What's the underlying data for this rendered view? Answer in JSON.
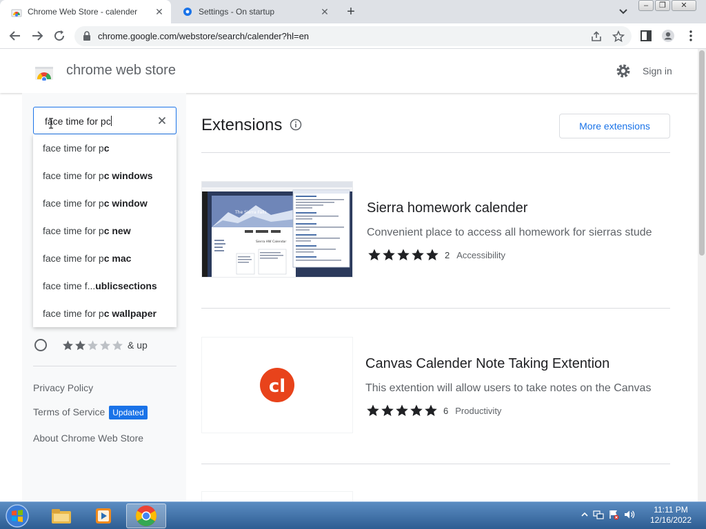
{
  "browser": {
    "tabs": [
      {
        "title": "Chrome Web Store - calender",
        "active": true
      },
      {
        "title": "Settings - On startup",
        "active": false
      }
    ],
    "address_url": "chrome.google.com/webstore/search/calender?hl=en"
  },
  "header": {
    "store_name": "chrome web store",
    "sign_in": "Sign in"
  },
  "search": {
    "query": "face time for pc",
    "suggestions": [
      {
        "typed": "face time for p",
        "completion": "c"
      },
      {
        "typed": "face time for p",
        "completion": "c windows"
      },
      {
        "typed": "face time for p",
        "completion": "c window"
      },
      {
        "typed": "face time for p",
        "completion": "c new"
      },
      {
        "typed": "face time for p",
        "completion": "c mac"
      },
      {
        "typed": "face time f... ",
        "completion": "ublicsections"
      },
      {
        "typed": "face time for p",
        "completion": "c wallpaper"
      }
    ]
  },
  "filters": {
    "rating_filter": {
      "stars": 2,
      "label": "& up"
    }
  },
  "sidebar_links": {
    "privacy": "Privacy Policy",
    "terms": "Terms of Service",
    "terms_badge": "Updated",
    "about": "About Chrome Web Store"
  },
  "main": {
    "section_title": "Extensions",
    "more_button": "More extensions",
    "results": [
      {
        "name": "Sierra homework calender",
        "description": "Convenient place to access all homework for sierras stude",
        "rating": 5,
        "rating_count": "2",
        "category": "Accessibility"
      },
      {
        "name": "Canvas Calender Note Taking Extention",
        "description": "This extention will allow users to take notes on the Canvas",
        "rating": 5,
        "rating_count": "6",
        "category": "Productivity",
        "icon_text": "cl"
      }
    ],
    "thumbnail_text": {
      "site_title": "The Sierra Falls",
      "page_heading": "Sierra HW Calendar"
    }
  },
  "taskbar": {
    "time": "11:11 PM",
    "date": "12/16/2022"
  },
  "colors": {
    "accent_blue": "#1a73e8",
    "star_dark": "#202124",
    "star_light": "#bdc1c6",
    "canvas_red": "#e8431b"
  }
}
